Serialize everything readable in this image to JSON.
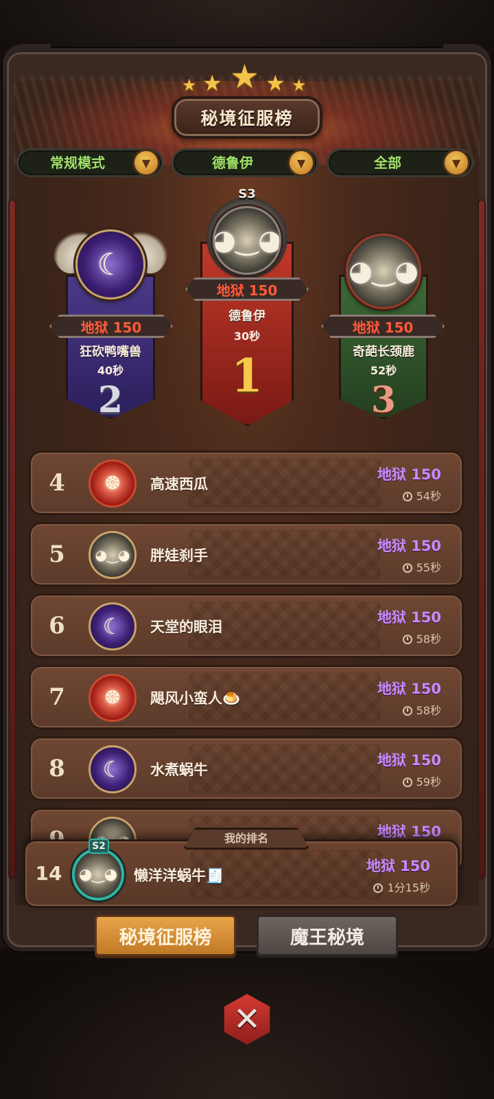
{
  "header": {
    "title": "秘境征服榜",
    "star_count": 5
  },
  "filters": [
    {
      "label": "常规模式"
    },
    {
      "label": "德鲁伊"
    },
    {
      "label": "全部"
    }
  ],
  "podium": {
    "first": {
      "season_badge": "S3",
      "score": "地狱 150",
      "name": "德鲁伊",
      "time": "30秒",
      "rank": "1",
      "emblem": "druid-face-icon"
    },
    "second": {
      "score": "地狱 150",
      "name": "狂砍鸭嘴兽",
      "time": "40秒",
      "rank": "2",
      "emblem": "crescent-moon-icon"
    },
    "third": {
      "score": "地狱 150",
      "name": "奇葩长颈鹿",
      "time": "52秒",
      "rank": "3",
      "emblem": "helmet-face-icon"
    }
  },
  "rows": [
    {
      "rank": "4",
      "name": "高速西瓜",
      "score": "地狱 150",
      "time": "54秒",
      "emblem": "fire-swirl-icon"
    },
    {
      "rank": "5",
      "name": "胖娃刹手",
      "score": "地狱 150",
      "time": "55秒",
      "emblem": "druid-face-icon"
    },
    {
      "rank": "6",
      "name": "天堂的眼泪",
      "score": "地狱 150",
      "time": "58秒",
      "emblem": "crescent-moon-icon"
    },
    {
      "rank": "7",
      "name": "飓风小蛮人🍮",
      "score": "地狱 150",
      "time": "58秒",
      "emblem": "fire-swirl-icon"
    },
    {
      "rank": "8",
      "name": "水煮蜗牛",
      "score": "地狱 150",
      "time": "59秒",
      "emblem": "crescent-moon-icon"
    },
    {
      "rank": "9",
      "name": "",
      "score": "地狱 150",
      "time": "",
      "emblem": "druid-face-icon"
    }
  ],
  "my_rank": {
    "tag": "我的排名",
    "rank": "14",
    "season_badge": "S2",
    "name": "懒洋洋蜗牛🧾",
    "score": "地狱 150",
    "time": "1分15秒",
    "emblem": "druid-face-icon"
  },
  "tabs": [
    {
      "label": "秘境征服榜",
      "active": true
    },
    {
      "label": "魔王秘境",
      "active": false
    }
  ],
  "colors": {
    "score_purple": "#c78bff",
    "score_red": "#ff5a3a",
    "filter_green": "#9fe06a",
    "active_tab": "#e8a44a"
  }
}
